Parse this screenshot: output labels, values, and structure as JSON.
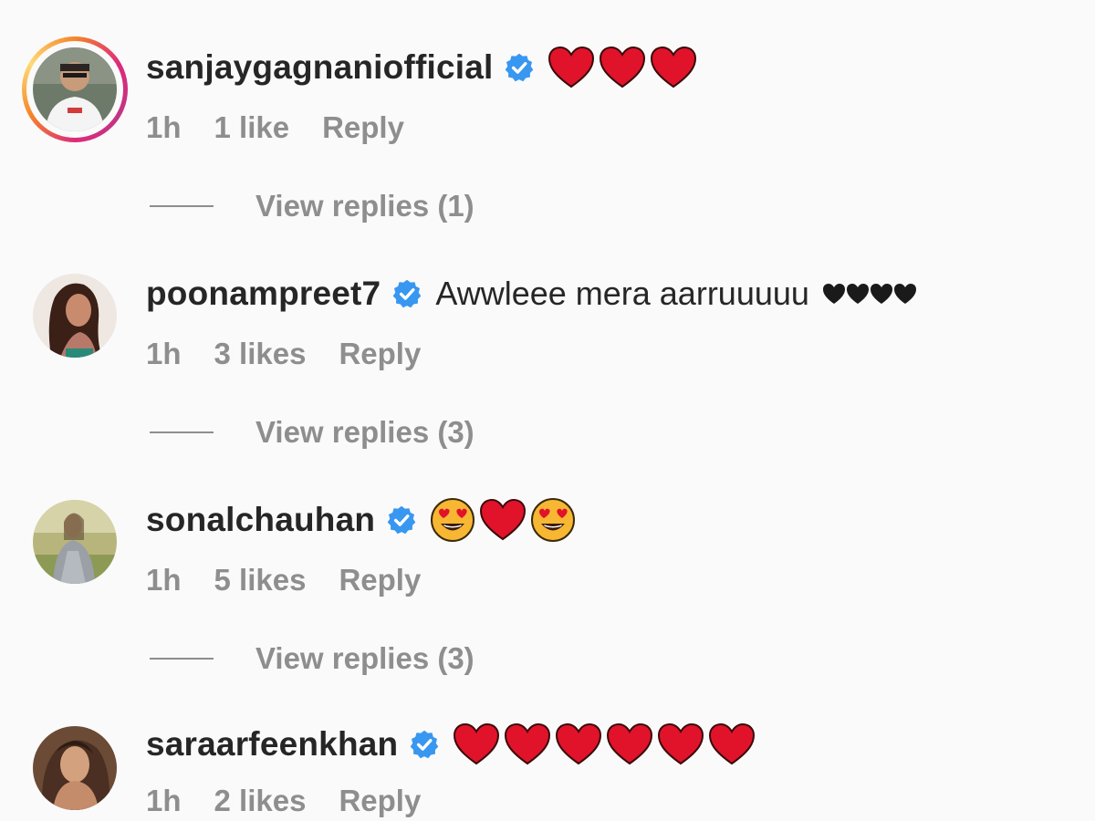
{
  "comments": [
    {
      "username": "sanjaygagnaniofficial",
      "text": "",
      "time": "1h",
      "likes": "1 like",
      "reply": "Reply",
      "view_replies": "View replies (1)",
      "avatar": "avatar-sanjay"
    },
    {
      "username": "poonampreet7",
      "text": "Awwleee mera aarruuuuu",
      "time": "1h",
      "likes": "3 likes",
      "reply": "Reply",
      "view_replies": "View replies (3)",
      "avatar": "avatar-poonam"
    },
    {
      "username": "sonalchauhan",
      "text": "",
      "time": "1h",
      "likes": "5 likes",
      "reply": "Reply",
      "view_replies": "View replies (3)",
      "avatar": "avatar-sonal"
    },
    {
      "username": "saraarfeenkhan",
      "text": "",
      "time": "1h",
      "likes": "2 likes",
      "reply": "Reply",
      "avatar": "avatar-sara"
    }
  ],
  "icons": {
    "verified": "verified-badge-icon",
    "heart": "red-heart-emoji",
    "heart_eyes": "heart-eyes-emoji",
    "black_heart": "black-heart-emoji"
  },
  "colors": {
    "username": "#262626",
    "secondary": "#8e8e8e",
    "verified": "#3897f0",
    "heart": "#e0132b",
    "background": "#fafafa"
  }
}
